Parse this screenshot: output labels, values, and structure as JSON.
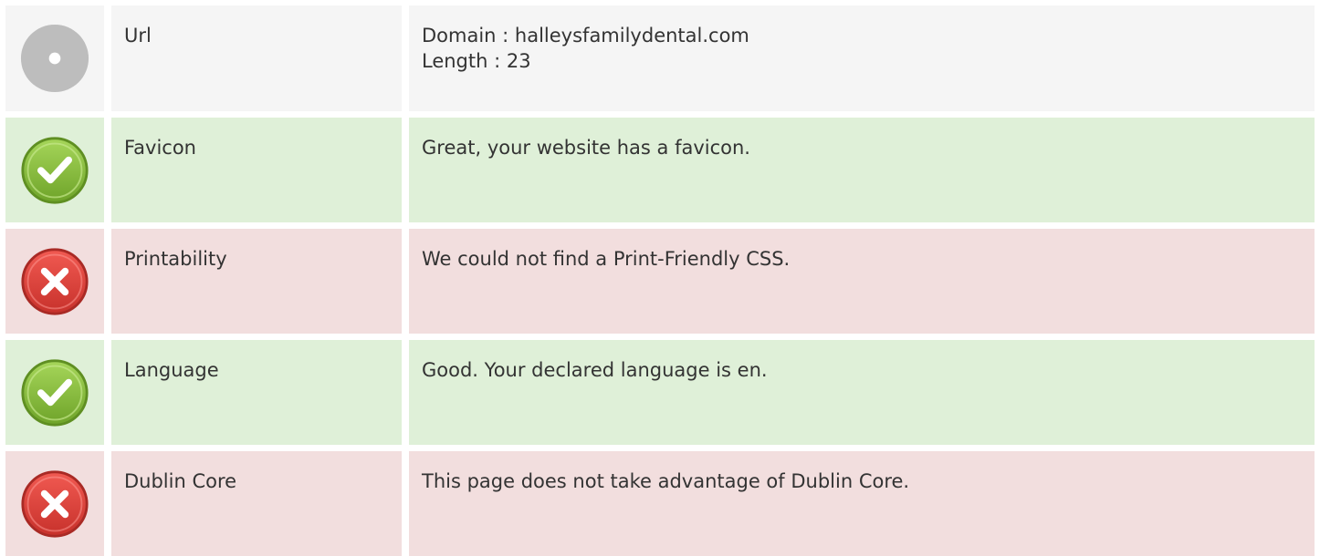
{
  "rows": [
    {
      "label": "Url",
      "status": "neutral",
      "icon": "info-dot-icon",
      "values": [
        "Domain : halleysfamilydental.com",
        "Length : 23"
      ]
    },
    {
      "label": "Favicon",
      "status": "pass",
      "icon": "check-icon",
      "values": [
        "Great, your website has a favicon."
      ]
    },
    {
      "label": "Printability",
      "status": "fail",
      "icon": "x-icon",
      "values": [
        "We could not find a Print-Friendly CSS."
      ]
    },
    {
      "label": "Language",
      "status": "pass",
      "icon": "check-icon",
      "values": [
        "Good. Your declared language is en."
      ]
    },
    {
      "label": "Dublin Core",
      "status": "fail",
      "icon": "x-icon",
      "values": [
        "This page does not take advantage of Dublin Core."
      ]
    }
  ],
  "colors": {
    "neutral_bg": "#f5f5f5",
    "pass_bg": "#dff0d8",
    "fail_bg": "#f2dede",
    "neutral_icon": "#bdbdbd",
    "pass_icon": "#8dc63f",
    "fail_icon": "#e0403a",
    "text": "#333333"
  }
}
